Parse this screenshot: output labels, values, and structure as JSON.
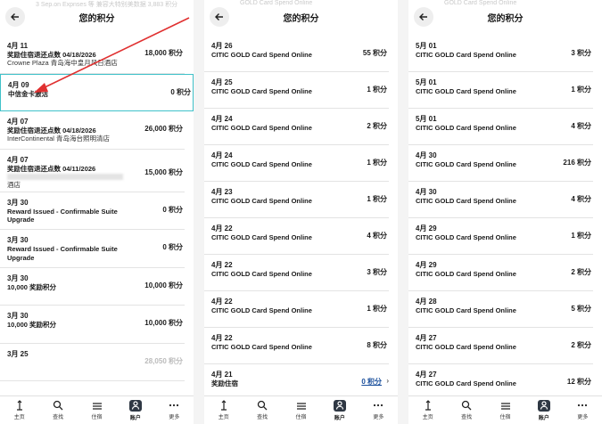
{
  "panels": [
    {
      "ghost_text": "3 Sep.on Expnses 等 兼容大特别美数据   3,883 积分",
      "title": "您的积分",
      "rows": [
        {
          "date": "4月 11",
          "desc": "奖励住宿退还点数 04/18/2026",
          "desc2": "Crowne Plaza 青岛海中皇月风日酒店",
          "pts": "18,000 积分"
        },
        {
          "date": "4月 09",
          "desc": "中信金卡激活",
          "desc2": "",
          "pts": "0 积分"
        },
        {
          "date": "4月 07",
          "desc": "奖励住宿退还点数 04/18/2026",
          "desc2": "InterContinental 青岛海台照明清店",
          "pts": "26,000 积分"
        },
        {
          "date": "4月 07",
          "desc": "奖励住宿退还点数 04/11/2026",
          "desc2": "酒店",
          "pts": "15,000 积分"
        },
        {
          "date": "3月 30",
          "desc": "Reward Issued - Confirmable Suite Upgrade",
          "desc2": "",
          "pts": "0 积分"
        },
        {
          "date": "3月 30",
          "desc": "Reward Issued - Confirmable Suite Upgrade",
          "desc2": "",
          "pts": "0 积分"
        },
        {
          "date": "3月 30",
          "desc": "10,000 奖励积分",
          "desc2": "",
          "pts": "10,000 积分"
        },
        {
          "date": "3月 30",
          "desc": "10,000 奖励积分",
          "desc2": "",
          "pts": "10,000 积分"
        },
        {
          "date": "3月 25",
          "desc": "",
          "desc2": "",
          "pts": "28,050 积分"
        }
      ]
    },
    {
      "ghost_text": "GOLD Card Spend Online",
      "title": "您的积分",
      "rows": [
        {
          "date": "4月 26",
          "desc": "CITIC GOLD Card Spend Online",
          "pts": "55 积分"
        },
        {
          "date": "4月 25",
          "desc": "CITIC GOLD Card Spend Online",
          "pts": "1 积分"
        },
        {
          "date": "4月 24",
          "desc": "CITIC GOLD Card Spend Online",
          "pts": "2 积分"
        },
        {
          "date": "4月 24",
          "desc": "CITIC GOLD Card Spend Online",
          "pts": "1 积分"
        },
        {
          "date": "4月 23",
          "desc": "CITIC GOLD Card Spend Online",
          "pts": "1 积分"
        },
        {
          "date": "4月 22",
          "desc": "CITIC GOLD Card Spend Online",
          "pts": "4 积分"
        },
        {
          "date": "4月 22",
          "desc": "CITIC GOLD Card Spend Online",
          "pts": "3 积分"
        },
        {
          "date": "4月 22",
          "desc": "CITIC GOLD Card Spend Online",
          "pts": "1 积分"
        },
        {
          "date": "4月 22",
          "desc": "CITIC GOLD Card Spend Online",
          "pts": "8 积分"
        },
        {
          "date": "4月 21",
          "desc": "奖励住宿",
          "pts": "0 积分",
          "link": true
        }
      ]
    },
    {
      "ghost_text": "GOLD Card Spend Online",
      "title": "您的积分",
      "rows": [
        {
          "date": "5月 01",
          "desc": "CITIC GOLD Card Spend Online",
          "pts": "3 积分"
        },
        {
          "date": "5月 01",
          "desc": "CITIC GOLD Card Spend Online",
          "pts": "1 积分"
        },
        {
          "date": "5月 01",
          "desc": "CITIC GOLD Card Spend Online",
          "pts": "4 积分"
        },
        {
          "date": "4月 30",
          "desc": "CITIC GOLD Card Spend Online",
          "pts": "216 积分"
        },
        {
          "date": "4月 30",
          "desc": "CITIC GOLD Card Spend Online",
          "pts": "4 积分"
        },
        {
          "date": "4月 29",
          "desc": "CITIC GOLD Card Spend Online",
          "pts": "1 积分"
        },
        {
          "date": "4月 29",
          "desc": "CITIC GOLD Card Spend Online",
          "pts": "2 积分"
        },
        {
          "date": "4月 28",
          "desc": "CITIC GOLD Card Spend Online",
          "pts": "5 积分"
        },
        {
          "date": "4月 27",
          "desc": "CITIC GOLD Card Spend Online",
          "pts": "2 积分"
        },
        {
          "date": "4月 27",
          "desc": "CITIC GOLD Card Spend Online",
          "pts": "12 积分"
        }
      ]
    }
  ],
  "tabs": [
    {
      "label": "主页",
      "icon": "ihg-logo-icon"
    },
    {
      "label": "查找",
      "icon": "search-icon"
    },
    {
      "label": "住宿",
      "icon": "bed-icon"
    },
    {
      "label": "账户",
      "icon": "account-icon",
      "active": true
    },
    {
      "label": "更多",
      "icon": "more-icon"
    }
  ],
  "colors": {
    "highlight_border": "#3fc1c9",
    "annotation_arrow": "#e03030",
    "active_tab_bg": "#2f3844",
    "link_blue": "#1a4f9c"
  }
}
